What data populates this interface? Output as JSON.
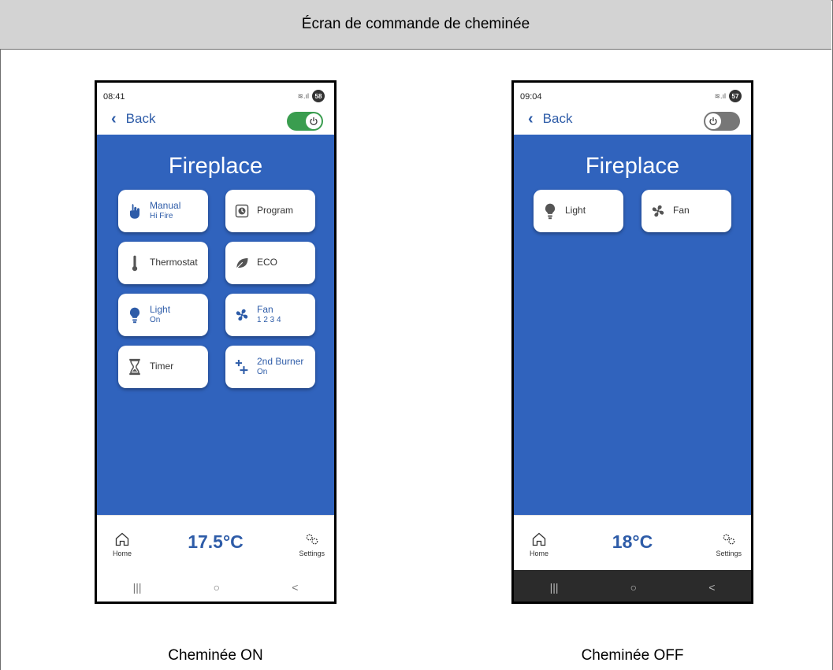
{
  "header": {
    "title": "Écran de commande de cheminée"
  },
  "phone_on": {
    "status_time": "08:41",
    "battery": "58",
    "back_label": "Back",
    "power_state": "on",
    "title": "Fireplace",
    "tiles": {
      "manual": {
        "label": "Manual",
        "sub": "Hi Fire"
      },
      "program": {
        "label": "Program"
      },
      "thermostat": {
        "label": "Thermostat"
      },
      "eco": {
        "label": "ECO"
      },
      "light": {
        "label": "Light",
        "sub": "On"
      },
      "fan": {
        "label": "Fan",
        "sub": "1 2 3 4"
      },
      "timer": {
        "label": "Timer"
      },
      "burner": {
        "label": "2nd Burner",
        "sub": "On"
      }
    },
    "temperature": "17.5°C",
    "nav_home": "Home",
    "nav_settings": "Settings",
    "sys_recent": "|||",
    "sys_home": "○",
    "sys_back": "<",
    "caption": "Cheminée ON"
  },
  "phone_off": {
    "status_time": "09:04",
    "battery": "57",
    "back_label": "Back",
    "power_state": "off",
    "title": "Fireplace",
    "tiles": {
      "light": {
        "label": "Light"
      },
      "fan": {
        "label": "Fan"
      }
    },
    "temperature": "18°C",
    "nav_home": "Home",
    "nav_settings": "Settings",
    "sys_recent": "|||",
    "sys_home": "○",
    "sys_back": "<",
    "caption": "Cheminée OFF"
  },
  "colors": {
    "app_blue": "#3063bd",
    "accent_blue": "#2e5ca8",
    "toggle_on": "#3a9d4f",
    "toggle_off": "#777777",
    "header_bg": "#d3d3d3"
  }
}
